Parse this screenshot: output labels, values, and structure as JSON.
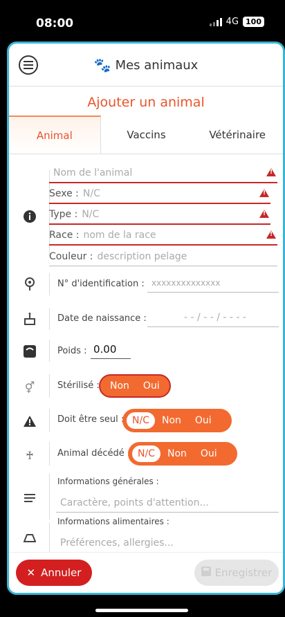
{
  "status": {
    "time": "08:00",
    "network": "4G",
    "battery": "100"
  },
  "header": {
    "title": "Mes animaux"
  },
  "form": {
    "title": "Ajouter un animal"
  },
  "tabs": [
    {
      "label": "Animal",
      "active": true
    },
    {
      "label": "Vaccins",
      "active": false
    },
    {
      "label": "Vétérinaire",
      "active": false
    }
  ],
  "fields": {
    "name": {
      "placeholder": "Nom de l'animal"
    },
    "sexe": {
      "label": "Sexe :",
      "value": "N/C"
    },
    "type": {
      "label": "Type :",
      "value": "N/C"
    },
    "race": {
      "label": "Race :",
      "placeholder": "nom de la race"
    },
    "couleur": {
      "label": "Couleur :",
      "placeholder": "description pelage"
    },
    "ident": {
      "label": "N° d'identification :",
      "placeholder": "xxxxxxxxxxxxxx"
    },
    "naissance": {
      "label": "Date de naissance :",
      "placeholder": "- - / - - / - - - -"
    },
    "poids": {
      "label": "Poids :",
      "value": "0.00"
    },
    "sterilise": {
      "label": "Stérilisé :",
      "options": [
        "Non",
        "Oui"
      ]
    },
    "seul": {
      "label": "Doit être seul :",
      "options": [
        "N/C",
        "Non",
        "Oui"
      ],
      "selected": "N/C"
    },
    "decede": {
      "label": "Animal décédé :",
      "options": [
        "N/C",
        "Non",
        "Oui"
      ],
      "selected": "N/C"
    },
    "infos_gen": {
      "label": "Informations générales :",
      "placeholder": "Caractère, points d'attention..."
    },
    "infos_alim": {
      "label": "Informations alimentaires :",
      "placeholder": "Préférences, allergies..."
    }
  },
  "actions": {
    "cancel": "Annuler",
    "save": "Enregistrer"
  },
  "colors": {
    "accent": "#f26a2f",
    "error": "#c62828",
    "frame": "#39b5d6"
  }
}
